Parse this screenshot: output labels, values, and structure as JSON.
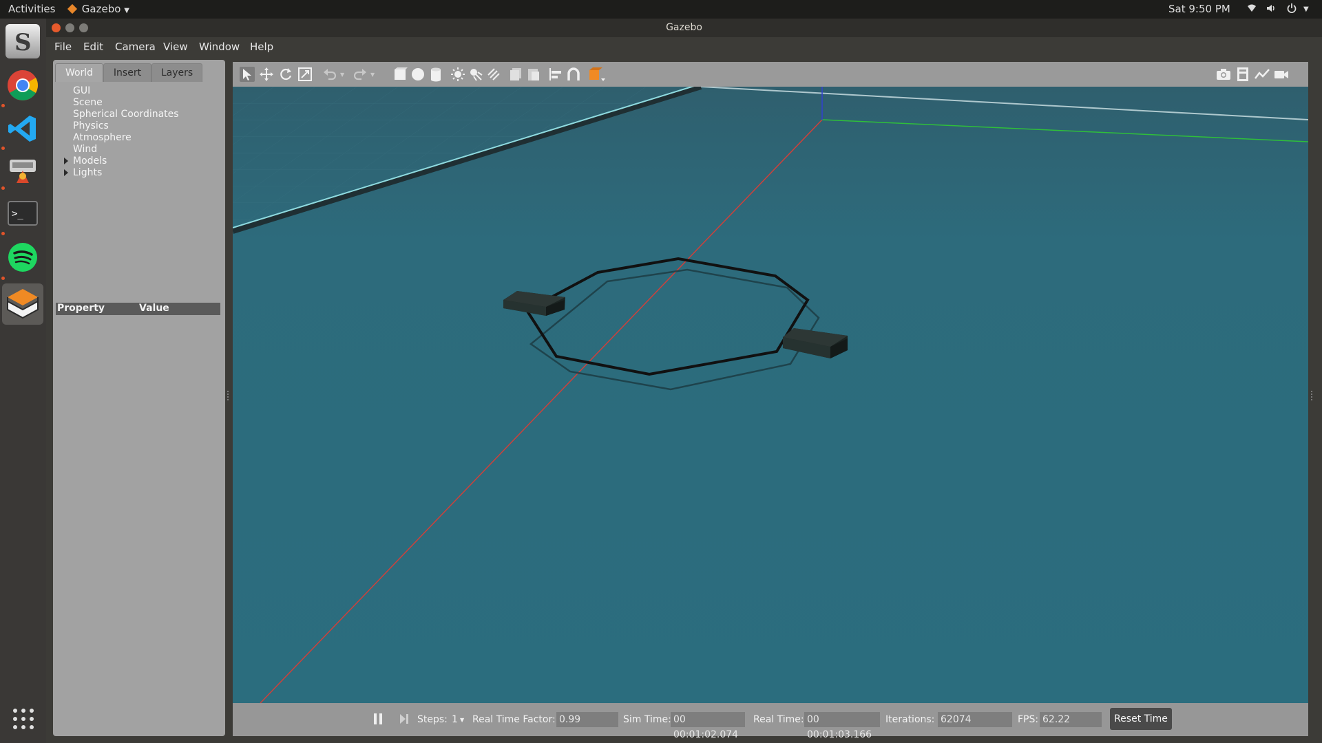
{
  "topbar": {
    "activities": "Activities",
    "app_menu": "Gazebo",
    "clock": "Sat  9:50 PM"
  },
  "window": {
    "title": "Gazebo"
  },
  "menu": [
    "File",
    "Edit",
    "Camera",
    "View",
    "Window",
    "Help"
  ],
  "left_panel": {
    "tabs": [
      "World",
      "Insert",
      "Layers"
    ],
    "active_tab": "World",
    "tree": [
      "GUI",
      "Scene",
      "Spherical Coordinates",
      "Physics",
      "Atmosphere",
      "Wind",
      "Models",
      "Lights"
    ],
    "property_header": "Property",
    "value_header": "Value"
  },
  "toolbar": {
    "icons": [
      "select-arrow-icon",
      "translate-icon",
      "rotate-icon",
      "scale-icon",
      "undo-icon",
      "redo-icon",
      "box-icon",
      "sphere-icon",
      "cylinder-icon",
      "point-light-icon",
      "spot-light-icon",
      "directional-light-icon",
      "copy-icon",
      "paste-icon",
      "align-icon",
      "snap-icon",
      "view-angle-icon",
      "screenshot-icon",
      "log-icon",
      "plot-icon",
      "record-video-icon"
    ]
  },
  "bottom": {
    "steps_label": "Steps:",
    "steps_value": "1",
    "rtf_label": "Real Time Factor:",
    "rtf_value": "0.99",
    "sim_label": "Sim Time:",
    "sim_value": "00 00:01:02.074",
    "real_label": "Real Time:",
    "real_value": "00 00:01:03.166",
    "iter_label": "Iterations:",
    "iter_value": "62074",
    "fps_label": "FPS:",
    "fps_value": "62.22",
    "reset_label": "Reset Time"
  },
  "colors": {
    "water": "#2f6f7f",
    "x_axis": "#d0403a",
    "y_axis": "#2fbf3a",
    "z_axis": "#3040d0"
  }
}
